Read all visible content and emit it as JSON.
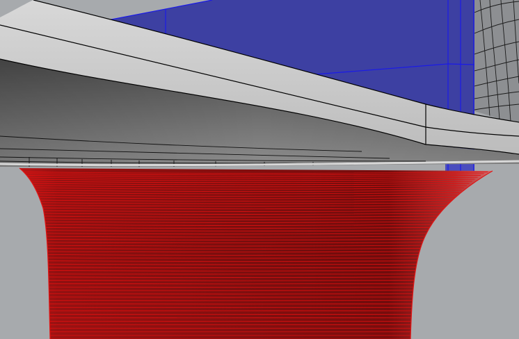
{
  "viewport": {
    "background_color": "#a7aaad",
    "display_mode": "shaded",
    "objects": [
      {
        "name": "blue-surface",
        "color": "#3b3ea0",
        "edge_color": "#1818e0",
        "selected": false
      },
      {
        "name": "gray-curved-surface",
        "color": "#c9c9c9",
        "edge_color": "#000000",
        "selected": false
      },
      {
        "name": "dark-curved-underside",
        "color": "#6e6e6e",
        "edge_color": "#000000",
        "selected": false
      },
      {
        "name": "red-trumpet-surface",
        "color": "#9c1515",
        "edge_color": "#e00000",
        "selected": true
      }
    ]
  }
}
